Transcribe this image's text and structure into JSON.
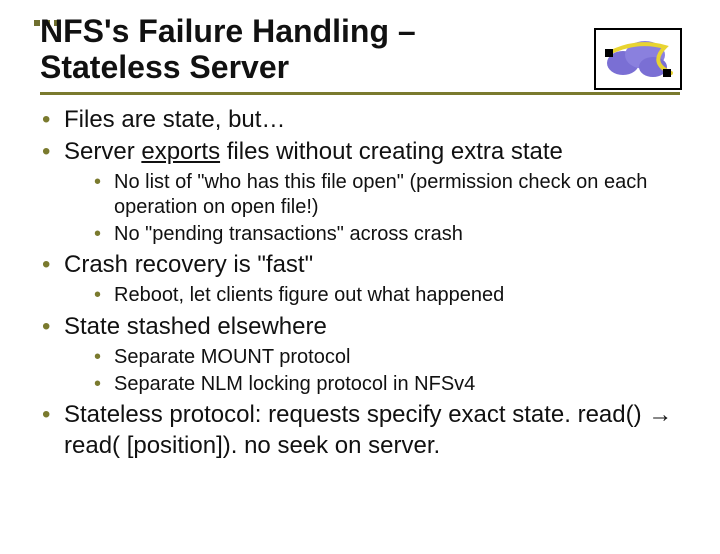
{
  "title_line1": "NFS's Failure Handling –",
  "title_line2": "Stateless Server",
  "bullets": {
    "b1": "Files are state, but…",
    "b2_pre": "Server ",
    "b2_underline": "exports",
    "b2_post": " files without creating extra state",
    "b2_sub1": "No list of \"who has this file open\" (permission check on each operation on open file!)",
    "b2_sub2": "No \"pending transactions\" across crash",
    "b3": "Crash recovery is \"fast\"",
    "b3_sub1": "Reboot, let clients figure out what happened",
    "b4": "State stashed elsewhere",
    "b4_sub1": "Separate MOUNT protocol",
    "b4_sub2": "Separate NLM locking protocol in NFSv4",
    "b5": "Stateless protocol:  requests specify exact state.  read() → read( [position]).  no seek on server."
  }
}
